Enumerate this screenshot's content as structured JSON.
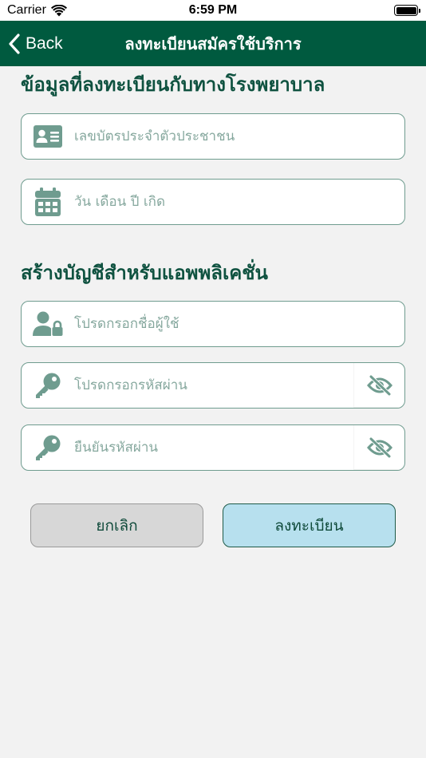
{
  "status_bar": {
    "carrier": "Carrier",
    "time": "6:59 PM"
  },
  "nav": {
    "back_label": "Back",
    "title": "ลงทะเบียนสมัครใช้บริการ"
  },
  "hospital_section": {
    "title": "ข้อมูลที่ลงทะเบียนกับทางโรงพยาบาล",
    "id_card_placeholder": "เลขบัตรประจำตัวประชาชน",
    "birthdate_placeholder": "วัน เดือน ปี เกิด"
  },
  "account_section": {
    "title": "สร้างบัญชีสำหรับแอพพลิเคชั่น",
    "username_placeholder": "โปรดกรอกชื่อผู้ใช้",
    "password_placeholder": "โปรดกรอกรหัสผ่าน",
    "confirm_password_placeholder": "ยืนยันรหัสผ่าน"
  },
  "actions": {
    "cancel_label": "ยกเลิก",
    "register_label": "ลงทะเบียน"
  },
  "colors": {
    "nav_background": "#005a3f",
    "accent_text": "#0f5240",
    "icon": "#6f9c8f",
    "register_button": "#b7e0ee",
    "cancel_button": "#d7d7d7"
  }
}
